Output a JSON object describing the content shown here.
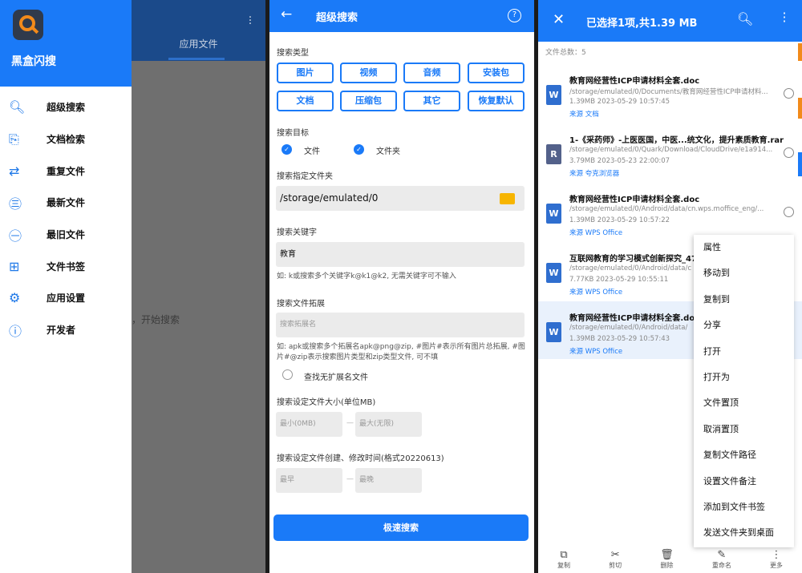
{
  "screen1": {
    "app_name": "黑盒闪搜",
    "behind_tab": "应用文件",
    "behind_start": "，开始搜索",
    "menu": [
      {
        "icon": "search-icon",
        "glyph": "🔍︎",
        "label": "超级搜索"
      },
      {
        "icon": "doc-search-icon",
        "glyph": "⎘",
        "label": "文档检索"
      },
      {
        "icon": "repeat-icon",
        "glyph": "⇄",
        "label": "重复文件"
      },
      {
        "icon": "new-icon",
        "glyph": "㊂",
        "label": "最新文件"
      },
      {
        "icon": "old-icon",
        "glyph": "㊀",
        "label": "最旧文件"
      },
      {
        "icon": "bookmark-icon",
        "glyph": "⊞",
        "label": "文件书签"
      },
      {
        "icon": "gear-icon",
        "glyph": "⚙",
        "label": "应用设置"
      },
      {
        "icon": "info-icon",
        "glyph": "ⓘ",
        "label": "开发者"
      }
    ]
  },
  "screen2": {
    "title": "超级搜索",
    "search_type_label": "搜索类型",
    "types": [
      "图片",
      "视频",
      "音频",
      "安装包",
      "文档",
      "压缩包",
      "其它",
      "恢复默认"
    ],
    "target_label": "搜索目标",
    "target_file": "文件",
    "target_folder": "文件夹",
    "folder_label": "搜索指定文件夹",
    "folder_value": "/storage/emulated/0",
    "keyword_label": "搜索关键字",
    "keyword_value": "教育",
    "keyword_hint": "如: k或搜索多个关键字k@k1@k2, 无需关键字可不输入",
    "ext_label": "搜索文件拓展",
    "ext_placeholder": "搜索拓展名",
    "ext_hint": "如: apk或搜索多个拓展名apk@png@zip, #图片#表示所有图片总拓展, #图片#@zip表示搜索图片类型和zip类型文件, 可不填",
    "no_ext_label": "查找无扩展名文件",
    "size_label": "搜索设定文件大小(单位MB)",
    "size_min": "最小(0MB)",
    "size_max": "最大(无限)",
    "time_label": "搜索设定文件创建、修改时间(格式20220613)",
    "time_start": "最早",
    "time_end": "最晚",
    "go_button": "极速搜索"
  },
  "screen3": {
    "title": "已选择1项,共1.39 MB",
    "count": "文件总数：5",
    "files": [
      {
        "name": "教育网经营性ICP申请材料全套.doc",
        "path": "/storage/emulated/0/Documents/教育网经营性ICP申请材料...",
        "meta": "1.39MB  2023-05-29 10:57:45",
        "source": "来源  文档",
        "type": "W"
      },
      {
        "name": "1-《采药师》-上医医国，中医...统文化，提升素质教育.rar",
        "path": "/storage/emulated/0/Quark/Download/CloudDrive/e1a914...",
        "meta": "3.79MB  2023-05-23 22:00:07",
        "source": "来源  夸克浏览器",
        "type": "R"
      },
      {
        "name": "教育网经营性ICP申请材料全套.doc",
        "path": "/storage/emulated/0/Android/data/cn.wps.moffice_eng/...",
        "meta": "1.39MB  2023-05-29 10:57:22",
        "source": "来源  WPS Office",
        "type": "W"
      },
      {
        "name": "互联网教育的学习模式创新探究_47",
        "path": "/storage/emulated/0/Android/data/c",
        "meta": "7.77KB  2023-05-29 10:55:11",
        "source": "来源  WPS Office",
        "type": "W"
      },
      {
        "name": "教育网经营性ICP申请材料全套.doc",
        "path": "/storage/emulated/0/Android/data/",
        "meta": "1.39MB  2023-05-29 10:57:43",
        "source": "来源  WPS Office",
        "type": "W"
      }
    ],
    "context_menu": [
      "属性",
      "移动到",
      "复制到",
      "分享",
      "打开",
      "打开为",
      "文件置顶",
      "取消置顶",
      "复制文件路径",
      "设置文件备注",
      "添加到文件书签",
      "发送文件夹到桌面"
    ],
    "bottom_bar": [
      {
        "icon": "copy-icon",
        "glyph": "⧉",
        "label": "复制"
      },
      {
        "icon": "cut-icon",
        "glyph": "✂",
        "label": "剪切"
      },
      {
        "icon": "delete-icon",
        "glyph": "🗑︎",
        "label": "删除"
      },
      {
        "icon": "rename-icon",
        "glyph": "✎",
        "label": "重命名"
      },
      {
        "icon": "more-icon",
        "glyph": "⋮",
        "label": "更多"
      }
    ]
  },
  "colors": {
    "accent": "#1a7af8",
    "overlay": "#6f6f6f",
    "folder": "#f7b500"
  }
}
